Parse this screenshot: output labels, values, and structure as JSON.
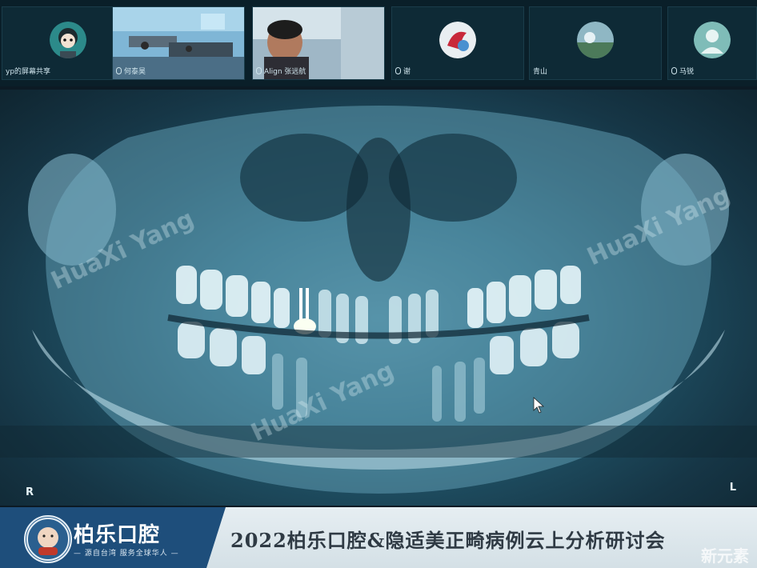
{
  "participants": [
    {
      "name": "yp的屏幕共享",
      "type": "avatar"
    },
    {
      "name": "何泰昊",
      "type": "video"
    },
    {
      "name": "Align 张远航",
      "type": "video"
    },
    {
      "name": "谢",
      "type": "avatar"
    },
    {
      "name": "青山",
      "type": "avatar"
    },
    {
      "name": "马锐",
      "type": "avatar"
    }
  ],
  "xray": {
    "watermark": "HuaXi Yang",
    "label_right_side": "R",
    "label_left_side": "L"
  },
  "banner": {
    "brand_name": "柏乐口腔",
    "brand_tagline": "— 源自台湾 服务全球华人 —",
    "logo_ring_text": "A BETTER LIFE DENTAL",
    "event_title": "2022柏乐口腔&隐适美正畸病例云上分析研讨会",
    "corner_watermark": "新元素"
  },
  "colors": {
    "banner_brand_bg": "#1e4e7b",
    "xray_tint": "#4e8aa0"
  }
}
